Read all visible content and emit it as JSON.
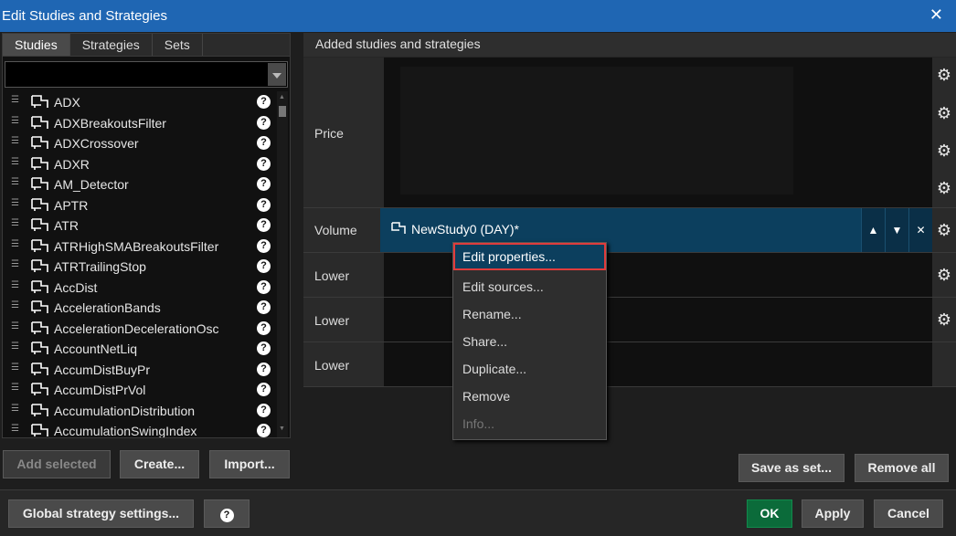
{
  "window": {
    "title": "Edit Studies and Strategies",
    "close_icon": "close-icon"
  },
  "left": {
    "tabs": [
      "Studies",
      "Strategies",
      "Sets"
    ],
    "search": {
      "value": "",
      "placeholder": ""
    },
    "items": [
      "ADX",
      "ADXBreakoutsFilter",
      "ADXCrossover",
      "ADXR",
      "AM_Detector",
      "APTR",
      "ATR",
      "ATRHighSMABreakoutsFilter",
      "ATRTrailingStop",
      "AccDist",
      "AccelerationBands",
      "AccelerationDecelerationOsc",
      "AccountNetLiq",
      "AccumDistBuyPr",
      "AccumDistPrVol",
      "AccumulationDistribution",
      "AccumulationSwingIndex"
    ],
    "buttons": {
      "add_selected": "Add selected",
      "create": "Create...",
      "import": "Import..."
    }
  },
  "right": {
    "header": "Added studies and strategies",
    "rows": {
      "price": "Price",
      "volume": "Volume",
      "lower1": "Lower",
      "lower2": "Lower",
      "lower3": "Lower"
    },
    "volume_study": "NewStudy0 (DAY)*",
    "buttons": {
      "save_as_set": "Save as set...",
      "remove_all": "Remove all"
    }
  },
  "context_menu": [
    "Edit properties...",
    "Edit sources...",
    "Rename...",
    "Share...",
    "Duplicate...",
    "Remove",
    "Info..."
  ],
  "footer": {
    "global_settings": "Global strategy settings...",
    "help": "?",
    "ok": "OK",
    "apply": "Apply",
    "cancel": "Cancel"
  },
  "colors": {
    "title_bar": "#1f66b3",
    "selection": "#0c3f5e",
    "ok": "#0b6b3a",
    "highlight_border": "#e03c3c"
  }
}
